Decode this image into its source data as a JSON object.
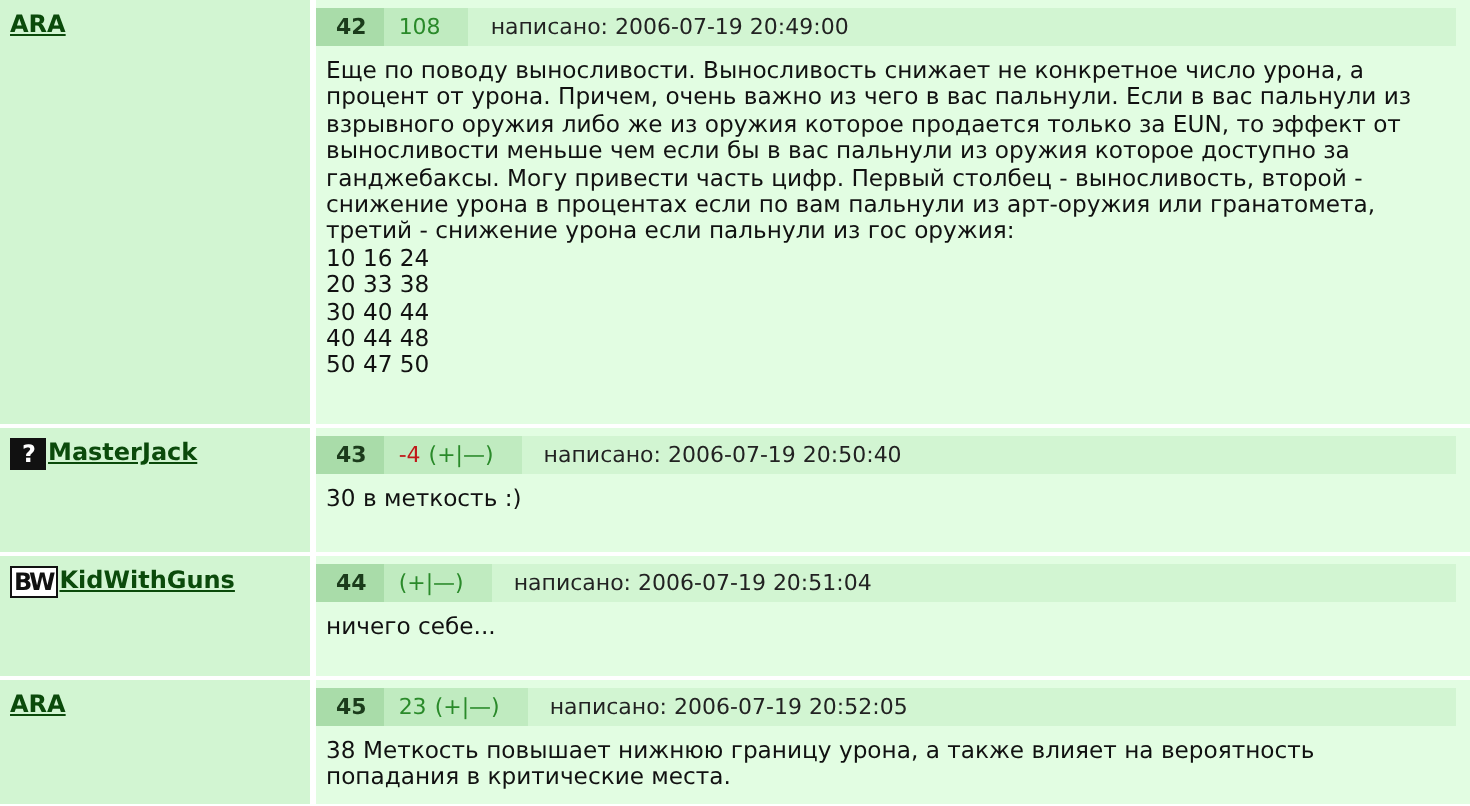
{
  "posts": [
    {
      "author": "ARA",
      "number": "42",
      "score": {
        "text": "108",
        "color": "#2a8a2a"
      },
      "posted": "написано: 2006-07-19 20:49:00",
      "body": "Еще по поводу выносливости. Выносливость снижает не конкретное число урона, а процент от урона. Причем, очень важно из чего в вас пальнули. Если в вас пальнули из взрывного оружия либо же из оружия которое продается только за EUN, то эффект от выносливости меньше чем если бы в вас пальнули из оружия которое доступно за ганджебаксы. Могу привести часть цифр. Первый столбец - выносливость, второй - снижение урона в процентах если по вам пальнули из арт-оружия или гранатомета, третий - снижение урона если пальнули из гос оружия:\n10 16 24\n20 33 38\n30 40 44\n40 44 48\n50 47 50"
    },
    {
      "author": "MasterJack",
      "badge": "?",
      "number": "43",
      "score": {
        "text": "-4",
        "color": "#c01818"
      },
      "vote_links": "(+|—)",
      "posted": "написано: 2006-07-19 20:50:40",
      "body": "30 в меткость :)"
    },
    {
      "author": "KidWithGuns",
      "badge": "BW",
      "number": "44",
      "vote_links": "(+|—)",
      "posted": "написано: 2006-07-19 20:51:04",
      "body": "ничего себе..."
    },
    {
      "author": "ARA",
      "number": "45",
      "score": {
        "text": "23",
        "color": "#2a8a2a"
      },
      "vote_links": "(+|—)",
      "posted": "написано: 2006-07-19 20:52:05",
      "body": "38 Меткость повышает нижнюю границу урона, а также влияет на вероятность попадания в критические места."
    }
  ]
}
